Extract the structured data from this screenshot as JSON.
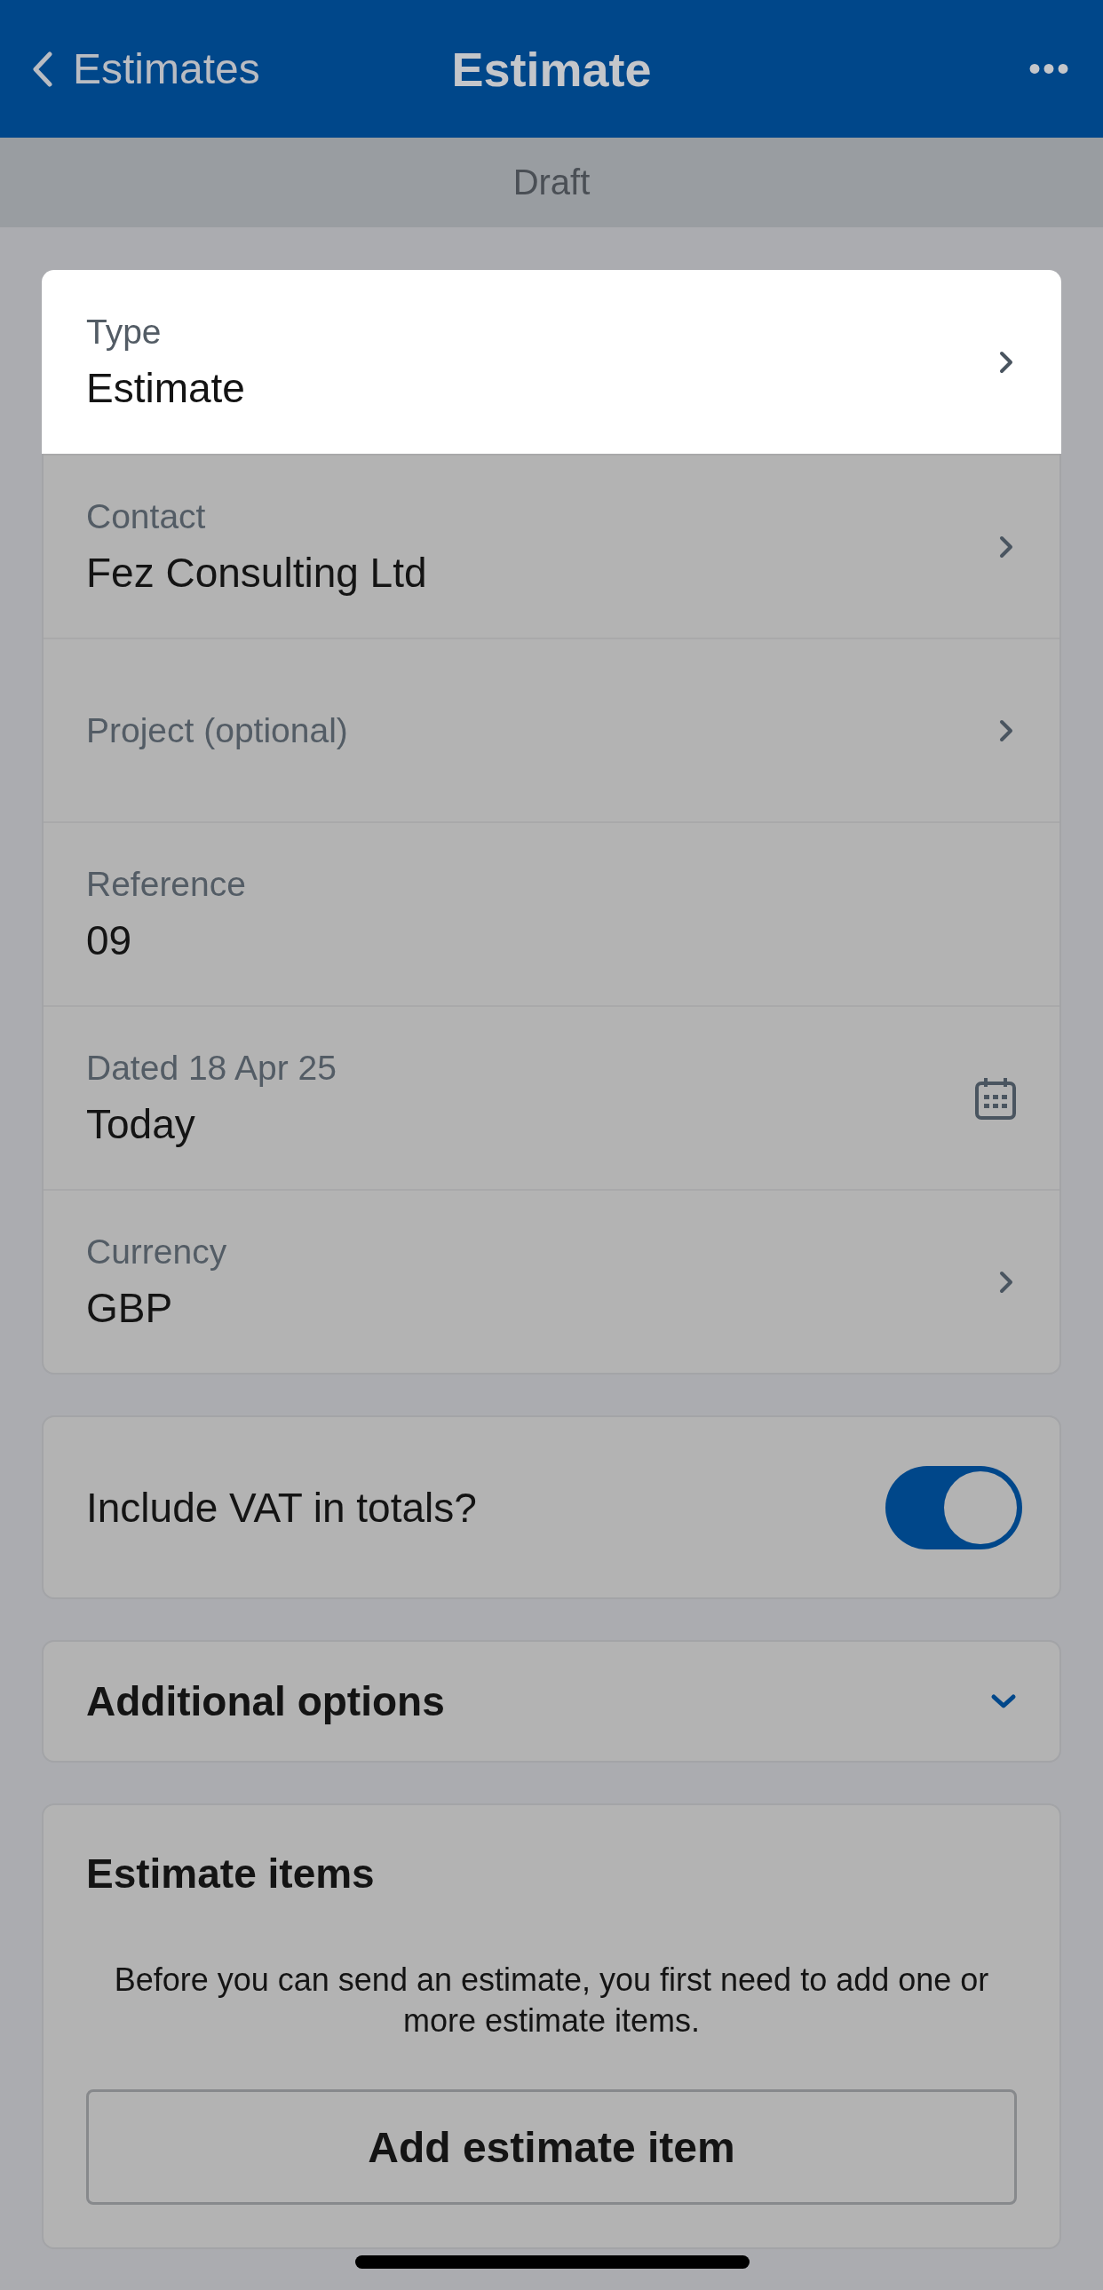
{
  "nav_bar": {
    "back_label": "Estimates",
    "title": "Estimate",
    "more_icon": "•••"
  },
  "status_banner": "Draft",
  "fields": [
    {
      "kind": "select",
      "label": "Type",
      "value": "Estimate",
      "highlighted": true
    },
    {
      "kind": "select",
      "label": "Contact",
      "value": "Fez Consulting Ltd",
      "highlighted": false
    },
    {
      "kind": "select",
      "label": "Project (optional)",
      "highlighted": false
    },
    {
      "kind": "text",
      "label": "Reference",
      "value": "09",
      "highlighted": false
    },
    {
      "kind": "date",
      "label": "Dated 18 Apr 25",
      "value": "Today",
      "highlighted": false
    },
    {
      "kind": "select",
      "label": "Currency",
      "value": "GBP",
      "highlighted": false
    }
  ],
  "vat_toggle": {
    "label": "Include VAT in totals?",
    "on": true
  },
  "additional_options": {
    "label": "Additional options",
    "expanded": false
  },
  "estimate_items": {
    "title": "Estimate items",
    "message": "Before you can send an estimate, you first need to add one or more estimate items.",
    "button": "Add estimate item"
  }
}
